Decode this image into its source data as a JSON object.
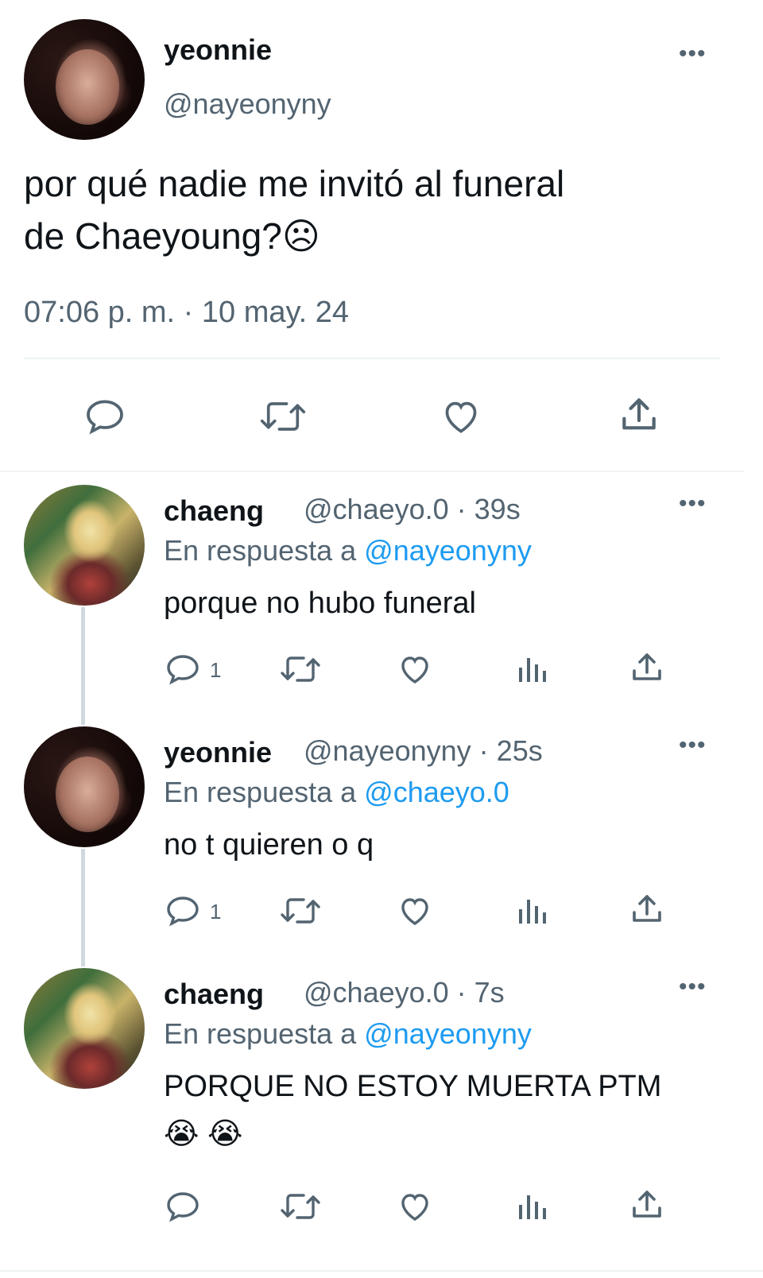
{
  "main_tweet": {
    "display_name": "yeonnie",
    "handle": "@nayeonyny",
    "text_line1": "por qué nadie me invitó al funeral",
    "text_line2": "de Chaeyoung?☹",
    "timestamp": "07:06 p. m. · 10 may. 24"
  },
  "replies": [
    {
      "display_name": "chaeng",
      "handle_time": "@chaeyo.0 · 39s",
      "replying_prefix": "En respuesta a",
      "replying_to": "@nayeonyny",
      "text": "porque no hubo funeral",
      "reply_count": "1"
    },
    {
      "display_name": "yeonnie",
      "handle_time": "@nayeonyny · 25s",
      "replying_prefix": "En respuesta a",
      "replying_to": "@chaeyo.0",
      "text": "no t quieren o q",
      "reply_count": "1"
    },
    {
      "display_name": "chaeng",
      "handle_time": "@chaeyo.0 · 7s",
      "replying_prefix": "En respuesta a",
      "replying_to": "@nayeonyny",
      "text": "PORQUE NO ESTOY MUERTA PTM",
      "emoji": "😭 😭",
      "reply_count": ""
    }
  ],
  "icons": {
    "more": "more-dots-icon",
    "reply": "speech-bubble-icon",
    "retweet": "retweet-arrows-icon",
    "like": "heart-icon",
    "views": "bar-chart-icon",
    "share": "share-upload-icon"
  },
  "colors": {
    "text": "#0f1419",
    "muted": "#536471",
    "link": "#1d9bf0",
    "divider": "#eff3f4",
    "thread_line": "#cfd9de"
  }
}
